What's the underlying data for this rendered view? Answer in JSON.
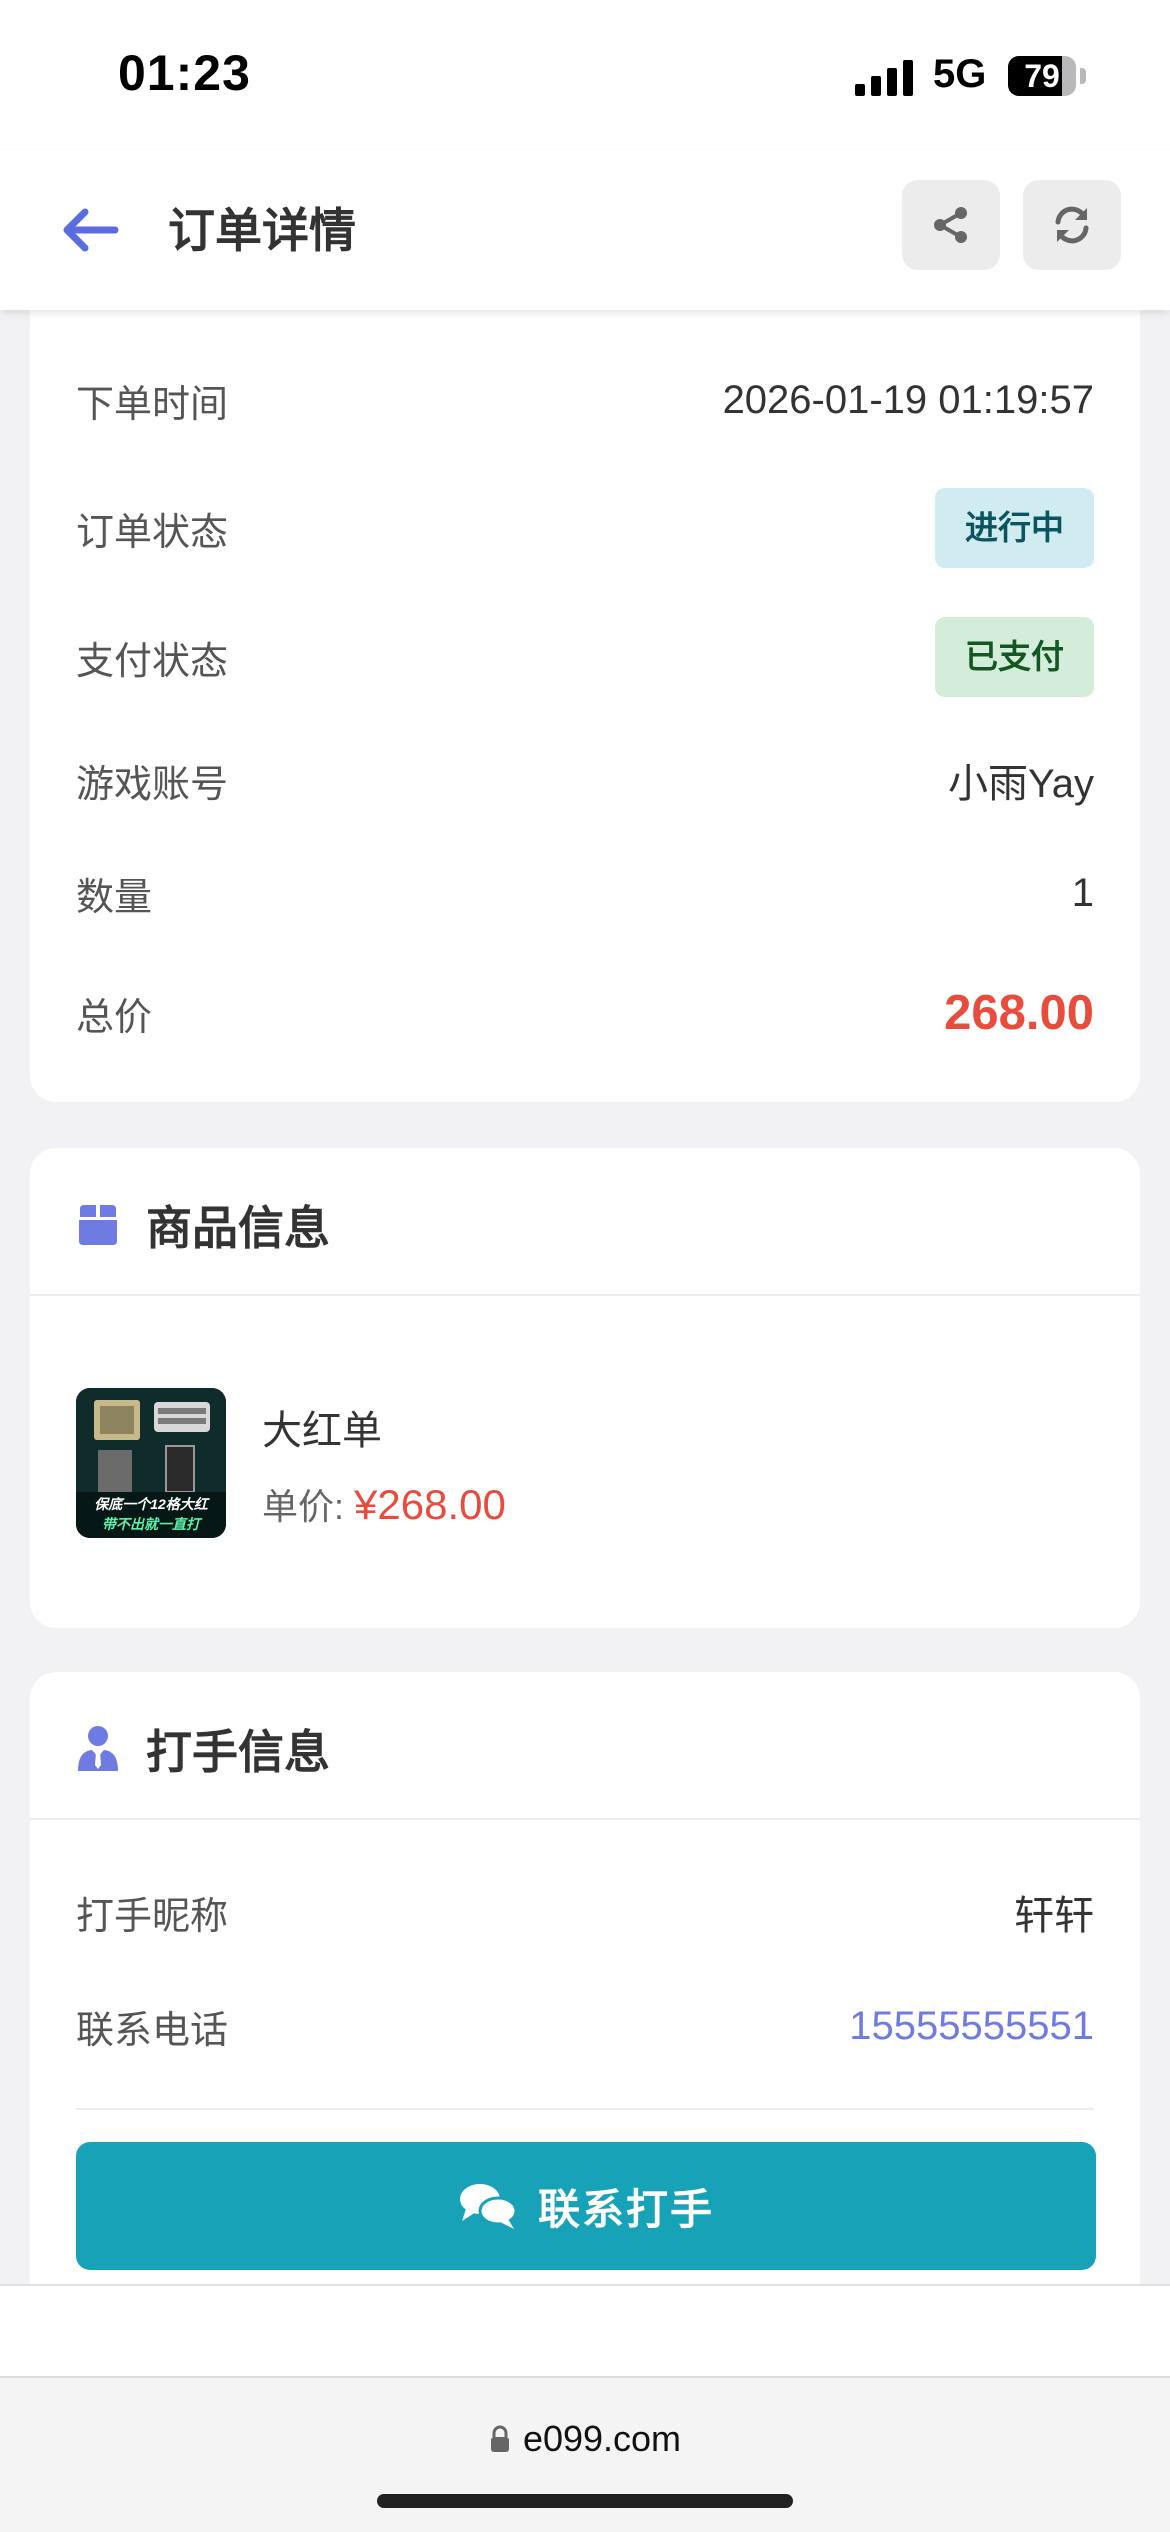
{
  "status_bar": {
    "time": "01:23",
    "network": "5G",
    "battery": "79",
    "battery_level": 0.79
  },
  "header": {
    "title": "订单详情",
    "back_icon": "arrow-left-icon",
    "share_icon": "share-icon",
    "refresh_icon": "refresh-icon"
  },
  "order_info": {
    "rows": [
      {
        "label": "下单时间",
        "value": "2026-01-19 01:19:57"
      },
      {
        "label": "订单状态",
        "value": "进行中"
      },
      {
        "label": "支付状态",
        "value": "已支付"
      },
      {
        "label": "游戏账号",
        "value": "小雨Yay"
      },
      {
        "label": "数量",
        "value": "1"
      },
      {
        "label": "总价",
        "value": "268.00"
      }
    ]
  },
  "product": {
    "section_title": "商品信息",
    "icon": "box-icon",
    "name": "大红单",
    "price_label": "单价:",
    "price": "¥268.00",
    "thumb_line1": "保底一个12格大红",
    "thumb_line2": "带不出就一直打"
  },
  "player": {
    "section_title": "打手信息",
    "icon": "user-tie-icon",
    "nickname_label": "打手昵称",
    "nickname": "轩轩",
    "phone_label": "联系电话",
    "phone": "15555555551",
    "contact_button": "联系打手",
    "contact_icon": "comments-icon"
  },
  "browser": {
    "url": "e099.com",
    "lock_icon": "lock-icon"
  },
  "colors": {
    "accent": "#6f7be0",
    "price_red": "#e74c3c",
    "button_teal": "#17a2b8"
  }
}
